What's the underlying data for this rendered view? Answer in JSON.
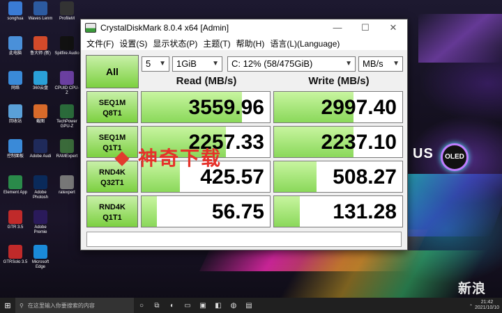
{
  "window": {
    "title": "CrystalDiskMark 8.0.4 x64 [Admin]",
    "buttons": {
      "minimize": "—",
      "maximize": "☐",
      "close": "✕"
    },
    "menu": [
      "文件(F)",
      "设置(S)",
      "显示状态(P)",
      "主题(T)",
      "帮助(H)",
      "语言(L)(Language)"
    ]
  },
  "controls": {
    "all_label": "All",
    "count": "5",
    "size": "1GiB",
    "drive": "C: 12% (58/475GiB)",
    "unit": "MB/s"
  },
  "headers": {
    "read": "Read (MB/s)",
    "write": "Write (MB/s)"
  },
  "rows": [
    {
      "line1": "SEQ1M",
      "line2": "Q8T1",
      "read": "3559.96",
      "write": "2997.40",
      "read_level": 0.78,
      "write_level": 0.62
    },
    {
      "line1": "SEQ1M",
      "line2": "Q1T1",
      "read": "2257.33",
      "write": "2237.10",
      "read_level": 0.66,
      "write_level": 0.62
    },
    {
      "line1": "RND4K",
      "line2": "Q32T1",
      "read": "425.57",
      "write": "508.27",
      "read_level": 0.3,
      "write_level": 0.33
    },
    {
      "line1": "RND4K",
      "line2": "Q1T1",
      "read": "56.75",
      "write": "131.28",
      "read_level": 0.12,
      "write_level": 0.2
    }
  ],
  "comment": "",
  "watermark": {
    "text": "神奇下载",
    "side_text": "新浪 众测"
  },
  "brand": {
    "asus": "US",
    "oled": "OLED"
  },
  "desktop_icons": [
    {
      "label": "songhua",
      "color": "#3a7bd5"
    },
    {
      "label": "Waves Lenm",
      "color": "#2c5aa0"
    },
    {
      "label": "ProfileM",
      "color": "#333"
    },
    {
      "label": "此电脑",
      "color": "#4a90d9"
    },
    {
      "label": "鲁大师 (新)",
      "color": "#d24a2a"
    },
    {
      "label": "Spitfire Audio",
      "color": "#111"
    },
    {
      "label": "网络",
      "color": "#3a8ad8"
    },
    {
      "label": "360云盘",
      "color": "#2aa0d8"
    },
    {
      "label": "CPUID CPU-Z",
      "color": "#6a3fa0"
    },
    {
      "label": "回收站",
      "color": "#5aa0d8"
    },
    {
      "label": "截图",
      "color": "#d86a2a"
    },
    {
      "label": "TechPower GPU-Z",
      "color": "#2a6a3a"
    },
    {
      "label": "控制面板",
      "color": "#3a8ad8"
    },
    {
      "label": "Adobe Audi",
      "color": "#1f2a5a"
    },
    {
      "label": "RAMExpert",
      "color": "#3a6a3a"
    },
    {
      "label": "Element App",
      "color": "#2a8a4a"
    },
    {
      "label": "Adobe Photosh",
      "color": "#0a2a5a"
    },
    {
      "label": "ratexpert",
      "color": "#777"
    },
    {
      "label": "GTR 3.5",
      "color": "#c02a2a"
    },
    {
      "label": "Adobe Premie",
      "color": "#2a1a5a"
    },
    {
      "label": "GTRSolo 3.5",
      "color": "#c02a2a"
    },
    {
      "label": "Microsoft Edge",
      "color": "#1a8ad8"
    }
  ],
  "taskbar": {
    "search_placeholder": "在这里输入你要搜索的内容",
    "time": "21:42",
    "date": "2021/10/10"
  }
}
